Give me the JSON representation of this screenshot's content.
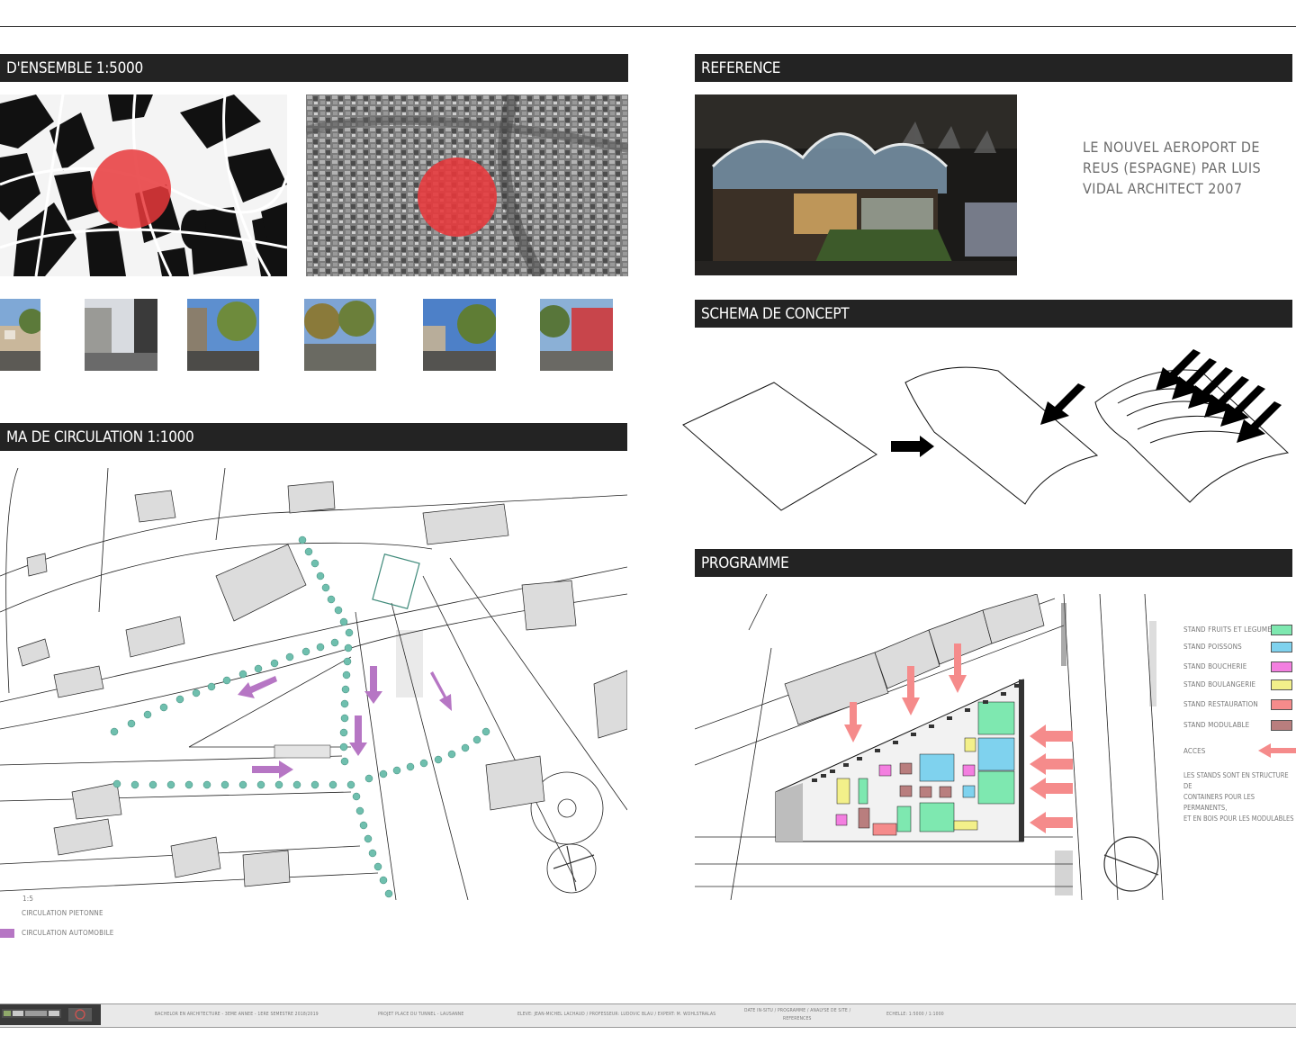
{
  "sections": {
    "plan_ensemble": "D'ENSEMBLE 1:5000",
    "reference": "REFERENCE",
    "schema_concept": "SCHEMA DE CONCEPT",
    "circulation": "MA DE CIRCULATION 1:1000",
    "programme": "PROGRAMME"
  },
  "reference_caption": [
    "LE NOUVEL AEROPORT DE",
    "REUS (ESPAGNE)  PAR LUIS",
    "VIDAL ARCHITECT 2007"
  ],
  "circulation_legend": {
    "scale_mark": "1:5",
    "pedestrian": "CIRCULATION PIETONNE",
    "automobile": "CIRCULATION AUTOMOBILE",
    "pedestrian_color": "#6fbfae",
    "automobile_color": "#b676c4"
  },
  "programme_legend": [
    {
      "label": "STAND FRUITS ET LEGUMES",
      "color": "#7ee8b0"
    },
    {
      "label": "STAND POISSONS",
      "color": "#7fd2ee"
    },
    {
      "label": "STAND BOUCHERIE",
      "color": "#f37fe0"
    },
    {
      "label": "STAND BOULANGERIE",
      "color": "#f3f08a"
    },
    {
      "label": "STAND RESTAURATION",
      "color": "#f58b8b"
    },
    {
      "label": "STAND MODULABLE",
      "color": "#b97e7e"
    },
    {
      "label": "ACCES",
      "color": "#f58b8b"
    }
  ],
  "programme_note": [
    "LES STANDS SONT EN STRUCTURE DE",
    "CONTAINERS POUR LES PERMANENTS,",
    "ET EN BOIS POUR LES MODULABLES"
  ],
  "footer": {
    "course": "BACHELOR EN ARCHITECTURE - 3EME ANNEE - 1ERE SEMESTRE 2018/2019",
    "project": "PROJET PLACE DU TUNNEL - LAUSANNE",
    "people": "ELEVE: JEAN-MICHEL LACHAUD / PROFESSEUR: LUDOVIC BLAU / EXPERT: M. WOHLSTRALAS",
    "content": [
      "DATE IN-SITU / PROGRAMME / ANALYSE DE SITE /",
      "REFERENCES"
    ],
    "scale": "ECHELLE: 1:5000 / 1:1000"
  },
  "colors": {
    "bar": "#232323",
    "marker": "#e8383b"
  }
}
